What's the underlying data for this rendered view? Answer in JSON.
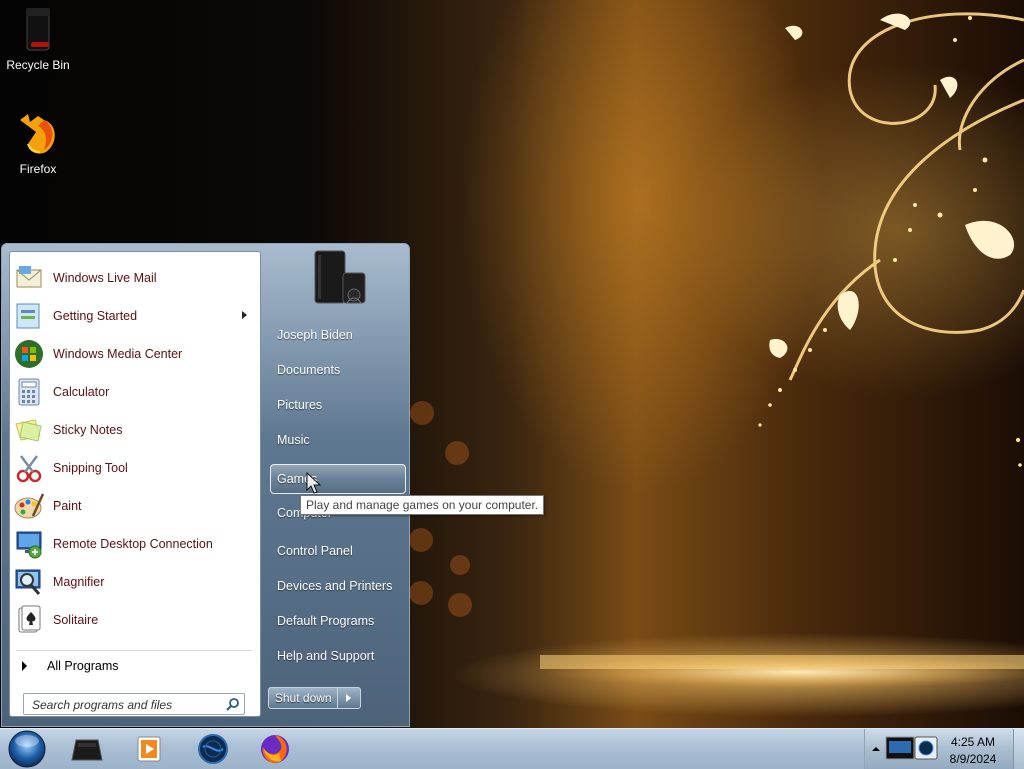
{
  "desktop": {
    "icons": [
      {
        "label": "Recycle Bin",
        "icon": "recycle-bin-icon"
      },
      {
        "label": "Firefox",
        "icon": "firefox-icon"
      }
    ]
  },
  "start_menu": {
    "programs": [
      {
        "label": "Windows Live Mail",
        "icon": "mail-icon"
      },
      {
        "label": "Getting Started",
        "icon": "getting-started-icon",
        "has_submenu": true
      },
      {
        "label": "Windows Media Center",
        "icon": "media-center-icon"
      },
      {
        "label": "Calculator",
        "icon": "calculator-icon"
      },
      {
        "label": "Sticky Notes",
        "icon": "sticky-notes-icon"
      },
      {
        "label": "Snipping Tool",
        "icon": "scissors-icon"
      },
      {
        "label": "Paint",
        "icon": "paint-palette-icon"
      },
      {
        "label": "Remote Desktop Connection",
        "icon": "remote-desktop-icon"
      },
      {
        "label": "Magnifier",
        "icon": "magnifier-icon"
      },
      {
        "label": "Solitaire",
        "icon": "solitaire-icon"
      }
    ],
    "all_programs": "All Programs",
    "search_placeholder": "Search programs and files",
    "user_picture": "game-console-icon",
    "right_links": [
      {
        "label": "Joseph Biden"
      },
      {
        "label": "Documents"
      },
      {
        "label": "Pictures"
      },
      {
        "label": "Music"
      },
      {
        "label": "Games",
        "hovered": true
      },
      {
        "label": "Computer"
      },
      {
        "label": "Control Panel"
      },
      {
        "label": "Devices and Printers"
      },
      {
        "label": "Default Programs"
      },
      {
        "label": "Help and Support"
      }
    ],
    "shutdown_label": "Shut down",
    "tooltip": "Play and manage games on your computer."
  },
  "taskbar": {
    "pinned": [
      "terminal-icon",
      "media-player-icon",
      "globe-icon",
      "firefox-icon"
    ],
    "tray_icon": "network-display-icon",
    "time": "4:25 AM",
    "date": "8/9/2024"
  },
  "colors": {
    "program_text": "#5c1011",
    "taskbar": "#aabfd4",
    "wallpaper_glow": "#f7c45a"
  }
}
